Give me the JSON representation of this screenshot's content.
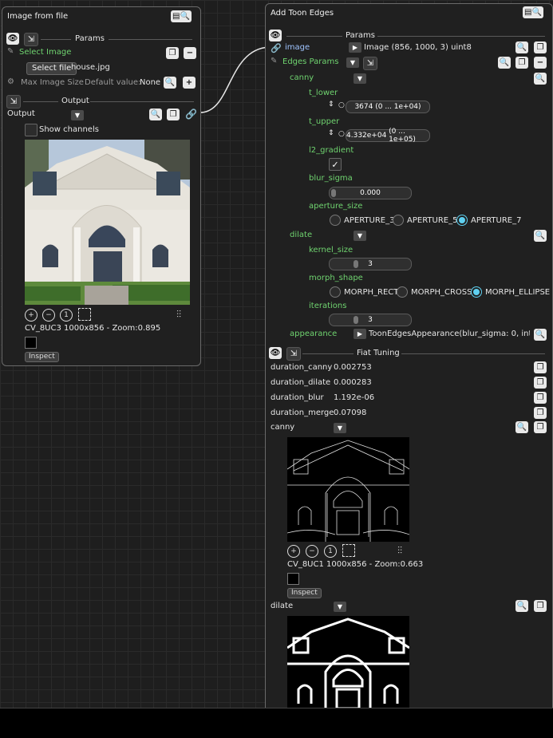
{
  "left_node": {
    "title": "Image from file",
    "params_label": "Params",
    "select_image_label": "Select Image",
    "select_file_button": "Select file",
    "file_name": "house.jpg",
    "max_image_size_label": "Max Image Size",
    "default_value_label": "Default value:",
    "default_value": "None",
    "output_section_label": "Output",
    "output_label": "Output",
    "show_channels_label": "Show channels",
    "image_info": "CV_8UC3 1000x856 - Zoom:0.895",
    "inspect_button": "Inspect"
  },
  "right_node": {
    "title": "Add Toon Edges",
    "params_label": "Params",
    "image_label": "image",
    "image_value": "Image (856, 1000, 3) uint8",
    "edges_params_label": "Edges Params",
    "canny_label": "canny",
    "t_lower_label": "t_lower",
    "t_lower_value": "3674",
    "t_lower_range": "(0 ... 1e+04)",
    "t_upper_label": "t_upper",
    "t_upper_value": "4.332e+04",
    "t_upper_range": "(0 ... 1e+05)",
    "l2_gradient_label": "l2_gradient",
    "blur_sigma_label": "blur_sigma",
    "blur_sigma_value": "0.000",
    "aperture_size_label": "aperture_size",
    "aperture_options": [
      "APERTURE_3",
      "APERTURE_5",
      "APERTURE_7"
    ],
    "aperture_selected": "APERTURE_7",
    "dilate_label": "dilate",
    "kernel_size_label": "kernel_size",
    "kernel_size_value": "3",
    "morph_shape_label": "morph_shape",
    "morph_options": [
      "MORPH_RECT",
      "MORPH_CROSS",
      "MORPH_ELLIPSE"
    ],
    "morph_selected": "MORPH_ELLIPSE",
    "iterations_label": "iterations",
    "iterations_value": "3",
    "appearance_label": "appearance",
    "appearance_value": "ToonEdgesAppearance(blur_sigma: 0, inten...",
    "fiat_tuning_label": "Fiat Tuning",
    "tuning_rows": [
      {
        "label": "duration_canny",
        "value": "0.002753"
      },
      {
        "label": "duration_dilate",
        "value": "0.000283"
      },
      {
        "label": "duration_blur",
        "value": "1.192e-06"
      },
      {
        "label": "duration_merge",
        "value": "0.07098"
      }
    ],
    "canny_image_label": "canny",
    "canny_image_info": "CV_8UC1 1000x856 - Zoom:0.663",
    "inspect_button": "Inspect",
    "dilate_image_label": "dilate"
  },
  "colors": {
    "canvas_bg": "#1e1e1e",
    "node_bg": "#202020",
    "node_border": "#6a6a6a",
    "accent_green": "#6fd36f",
    "accent_blue": "#9fc4ff",
    "radio_active": "#5fd0f0"
  }
}
